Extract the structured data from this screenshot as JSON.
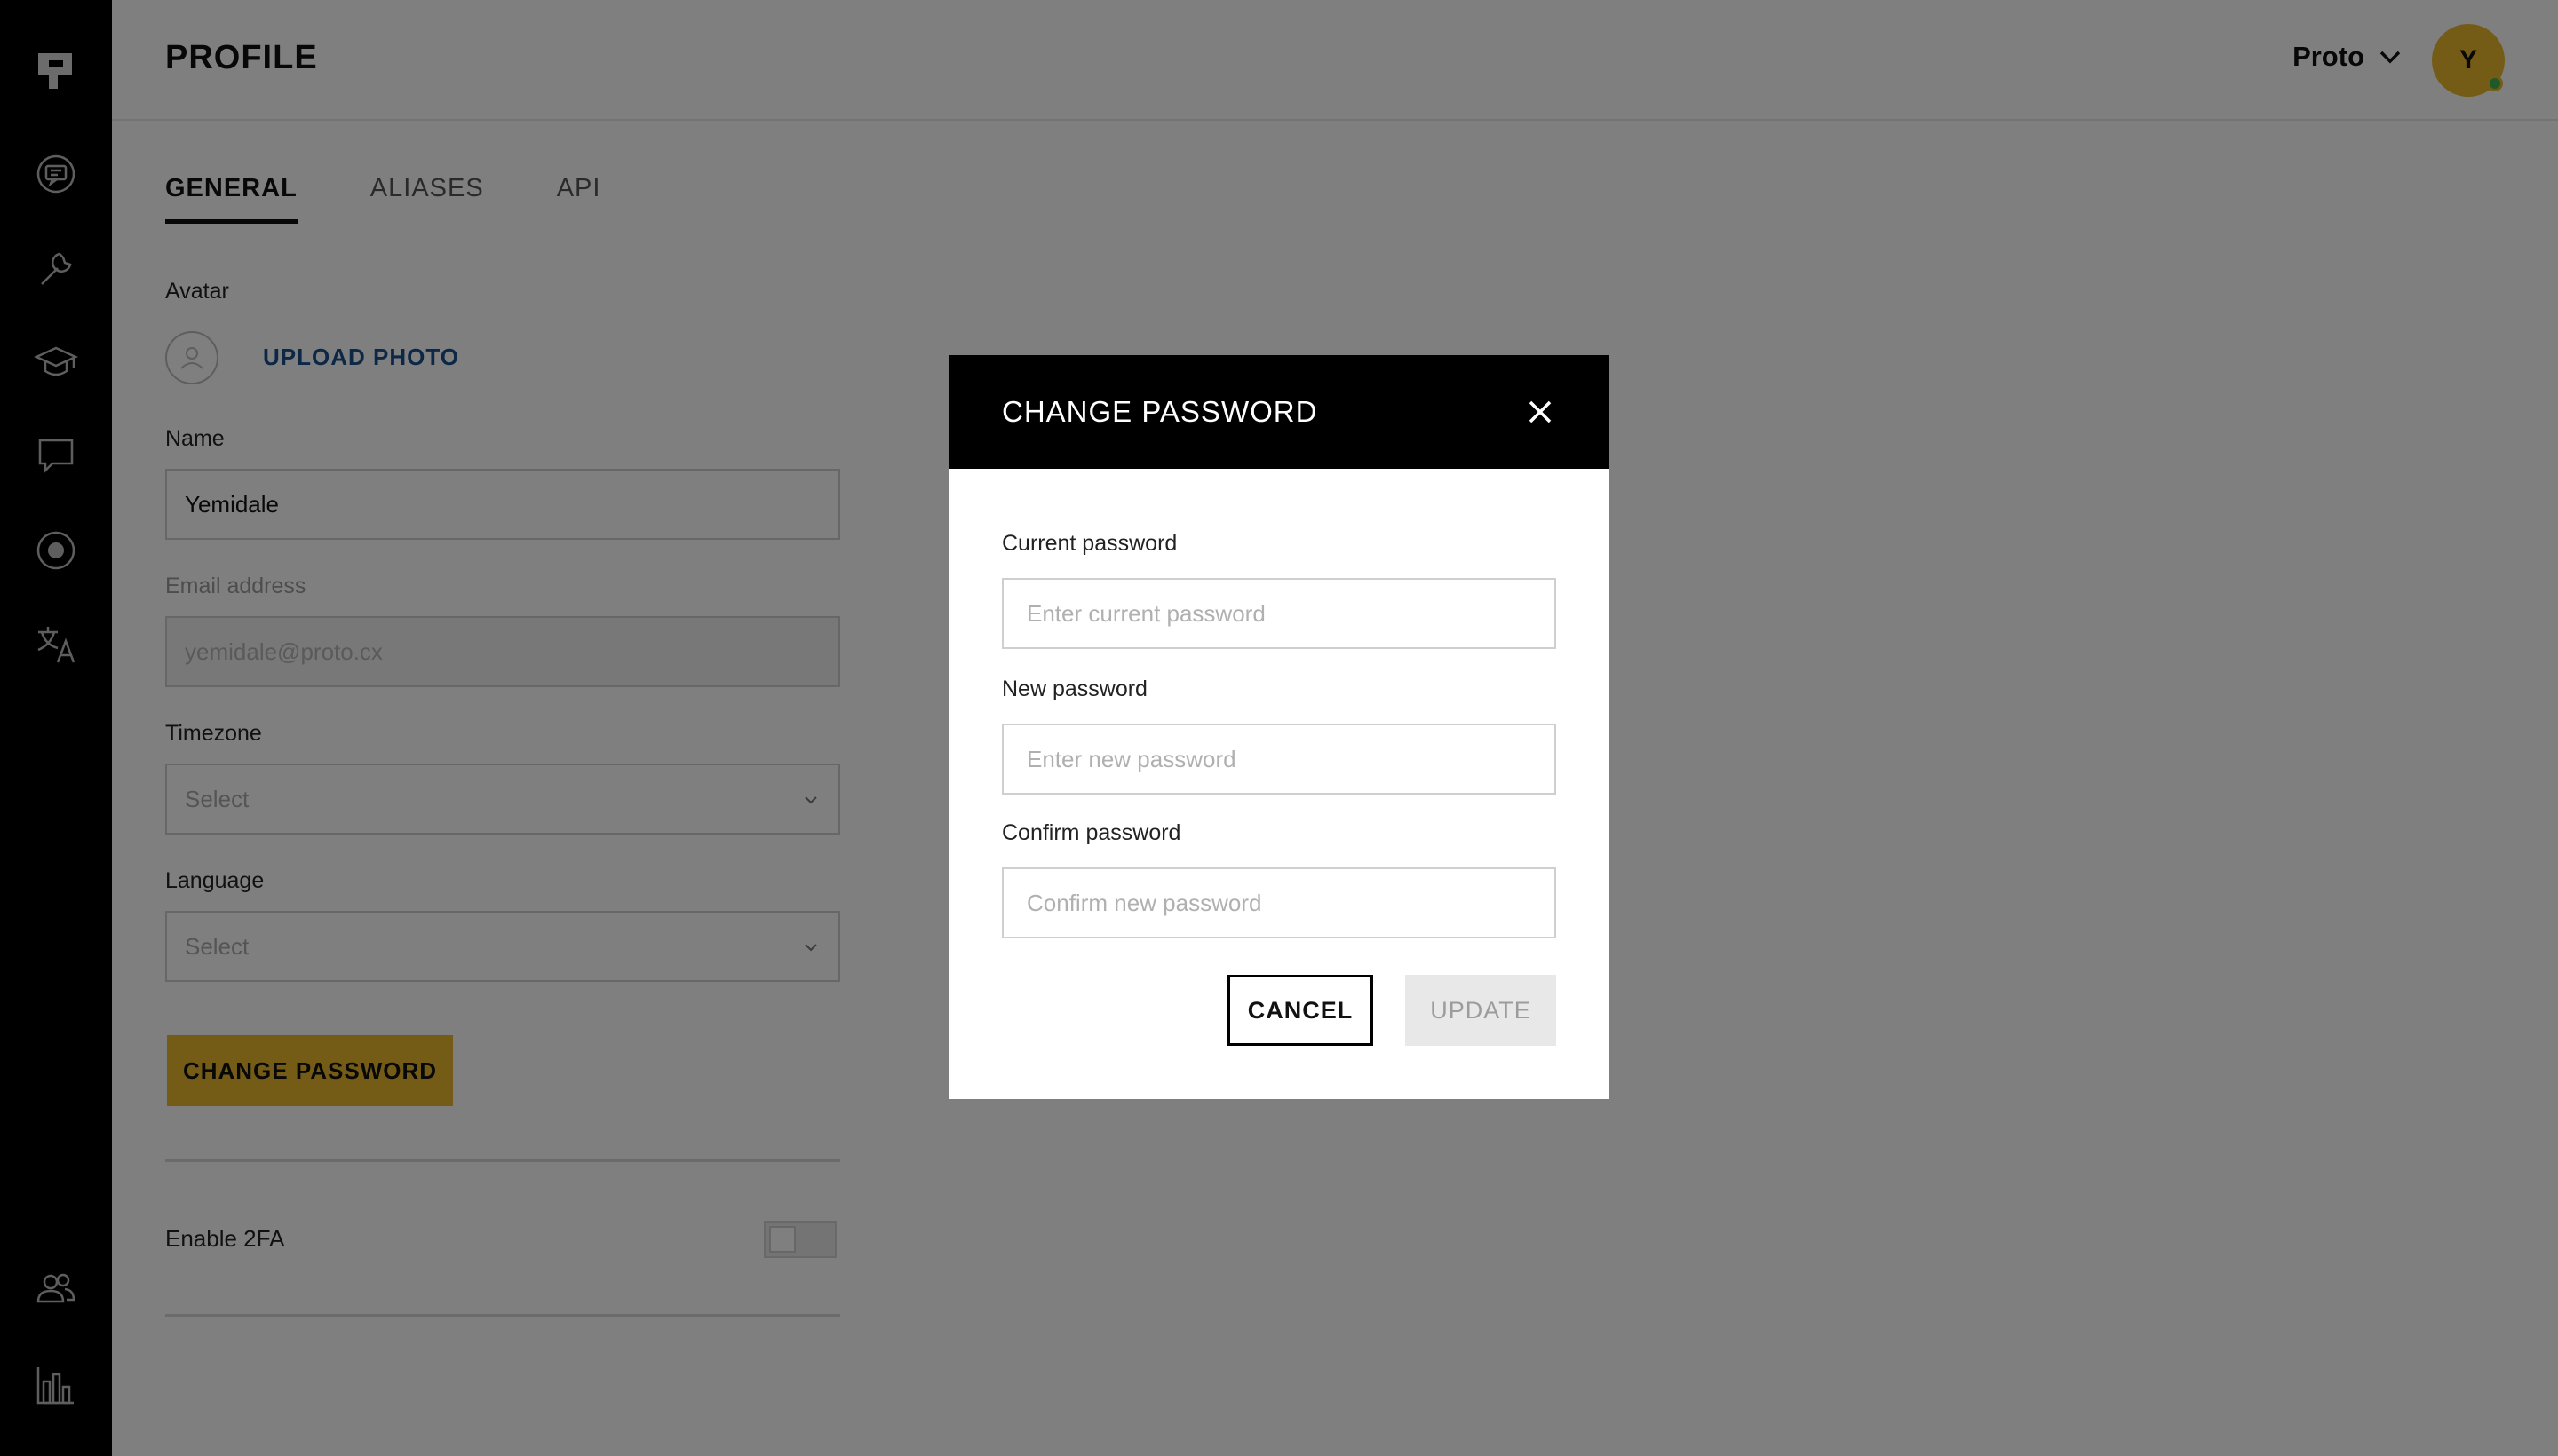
{
  "sidebar": {
    "icons": [
      "logo-icon",
      "chat-bubble-icon",
      "wrench-icon",
      "graduation-cap-icon",
      "comment-icon",
      "record-icon",
      "translate-icon",
      "users-icon",
      "bar-chart-icon"
    ]
  },
  "header": {
    "title": "PROFILE",
    "org_name": "Proto",
    "avatar_initial": "Y"
  },
  "tabs": [
    {
      "label": "GENERAL",
      "active": true
    },
    {
      "label": "ALIASES",
      "active": false
    },
    {
      "label": "API",
      "active": false
    }
  ],
  "form": {
    "avatar_label": "Avatar",
    "upload_label": "UPLOAD PHOTO",
    "name_label": "Name",
    "name_value": "Yemidale",
    "email_label": "Email address",
    "email_value": "yemidale@proto.cx",
    "timezone_label": "Timezone",
    "timezone_value": "Select",
    "language_label": "Language",
    "language_value": "Select",
    "change_password_label": "CHANGE PASSWORD",
    "twofa_label": "Enable 2FA",
    "twofa_enabled": false
  },
  "modal": {
    "title": "CHANGE PASSWORD",
    "current_label": "Current password",
    "current_placeholder": "Enter current password",
    "new_label": "New password",
    "new_placeholder": "Enter new password",
    "confirm_label": "Confirm password",
    "confirm_placeholder": "Confirm new password",
    "cancel_label": "CANCEL",
    "update_label": "UPDATE"
  },
  "colors": {
    "accent": "#e8b72c",
    "sidebar_bg": "#000000",
    "link": "#1b4f8f",
    "status_online": "#3fb34f"
  }
}
